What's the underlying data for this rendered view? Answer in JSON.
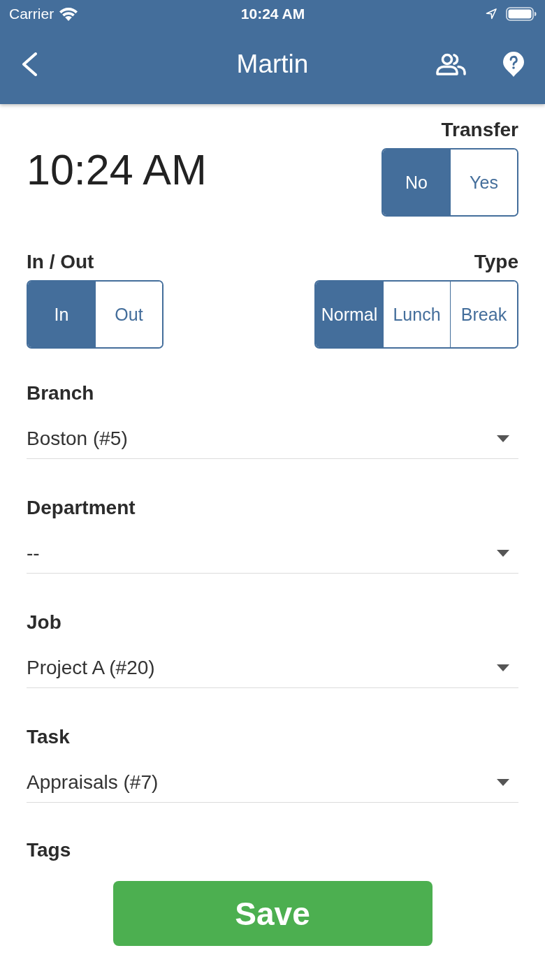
{
  "status_bar": {
    "carrier": "Carrier",
    "time": "10:24 AM"
  },
  "nav_bar": {
    "title": "Martin"
  },
  "clock": "10:24 AM",
  "transfer": {
    "label": "Transfer",
    "options": [
      {
        "label": "No",
        "selected": true
      },
      {
        "label": "Yes",
        "selected": false
      }
    ]
  },
  "in_out": {
    "label": "In / Out",
    "options": [
      {
        "label": "In",
        "selected": true
      },
      {
        "label": "Out",
        "selected": false
      }
    ]
  },
  "type": {
    "label": "Type",
    "options": [
      {
        "label": "Normal",
        "selected": true
      },
      {
        "label": "Lunch",
        "selected": false
      },
      {
        "label": "Break",
        "selected": false
      }
    ]
  },
  "fields": [
    {
      "label": "Branch",
      "value": "Boston (#5)"
    },
    {
      "label": "Department",
      "value": "--"
    },
    {
      "label": "Job",
      "value": "Project A (#20)"
    },
    {
      "label": "Task",
      "value": "Appraisals (#7)"
    }
  ],
  "next_section": {
    "label": "Tags"
  },
  "save_button": {
    "label": "Save"
  }
}
